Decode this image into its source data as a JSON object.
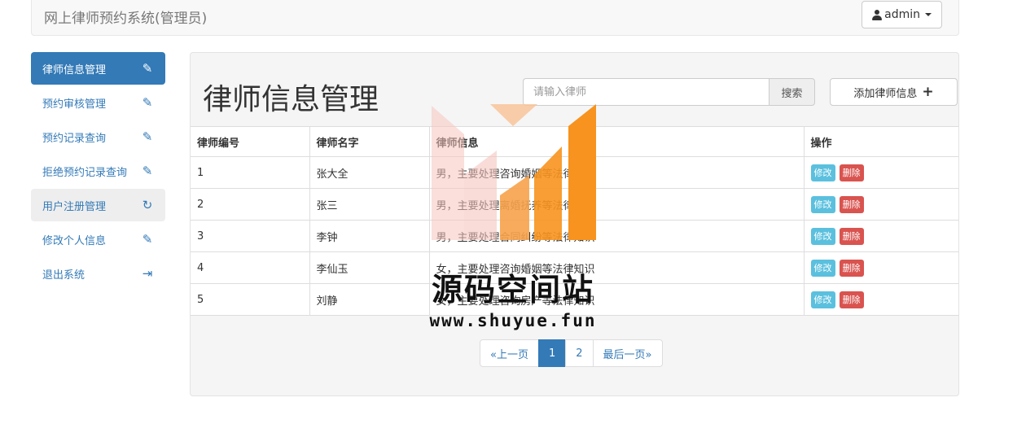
{
  "header": {
    "brand": "网上律师预约系统(管理员)",
    "user_label": "admin"
  },
  "sidebar": {
    "items": [
      {
        "label": "律师信息管理",
        "icon": "pencil-icon"
      },
      {
        "label": "预约审核管理",
        "icon": "pencil-icon"
      },
      {
        "label": "预约记录查询",
        "icon": "pencil-icon"
      },
      {
        "label": "拒绝预约记录查询",
        "icon": "pencil-icon"
      },
      {
        "label": "用户注册管理",
        "icon": "refresh-icon"
      },
      {
        "label": "修改个人信息",
        "icon": "pencil-icon"
      },
      {
        "label": "退出系统",
        "icon": "logout-icon"
      }
    ]
  },
  "main": {
    "title": "律师信息管理",
    "search_placeholder": "请输入律师",
    "search_button": "搜索",
    "add_button": "添加律师信息",
    "table": {
      "headers": [
        "律师编号",
        "律师名字",
        "律师信息",
        "操作"
      ],
      "rows": [
        [
          "1",
          "张大全",
          "男，主要处理咨询婚姻等法律知识"
        ],
        [
          "2",
          "张三",
          "男，主要处理离婚抚养等法律知识"
        ],
        [
          "3",
          "李钟",
          "男，主要处理合同纠纷等法律知识"
        ],
        [
          "4",
          "李仙玉",
          "女，主要处理咨询婚姻等法律知识"
        ],
        [
          "5",
          "刘静",
          "女，主要处理咨询房产等法律知识"
        ]
      ],
      "edit_label": "修改",
      "delete_label": "删除"
    },
    "pagination": {
      "prev": "«上一页",
      "pages": [
        "1",
        "2"
      ],
      "current": "1",
      "last": "最后一页»"
    }
  },
  "watermark": {
    "title": "源码空间站",
    "url": "www.shuyue.fun"
  },
  "colors": {
    "primary": "#337ab7",
    "info": "#5bc0de",
    "danger": "#d9534f",
    "watermark_orange": "#f7931e"
  }
}
